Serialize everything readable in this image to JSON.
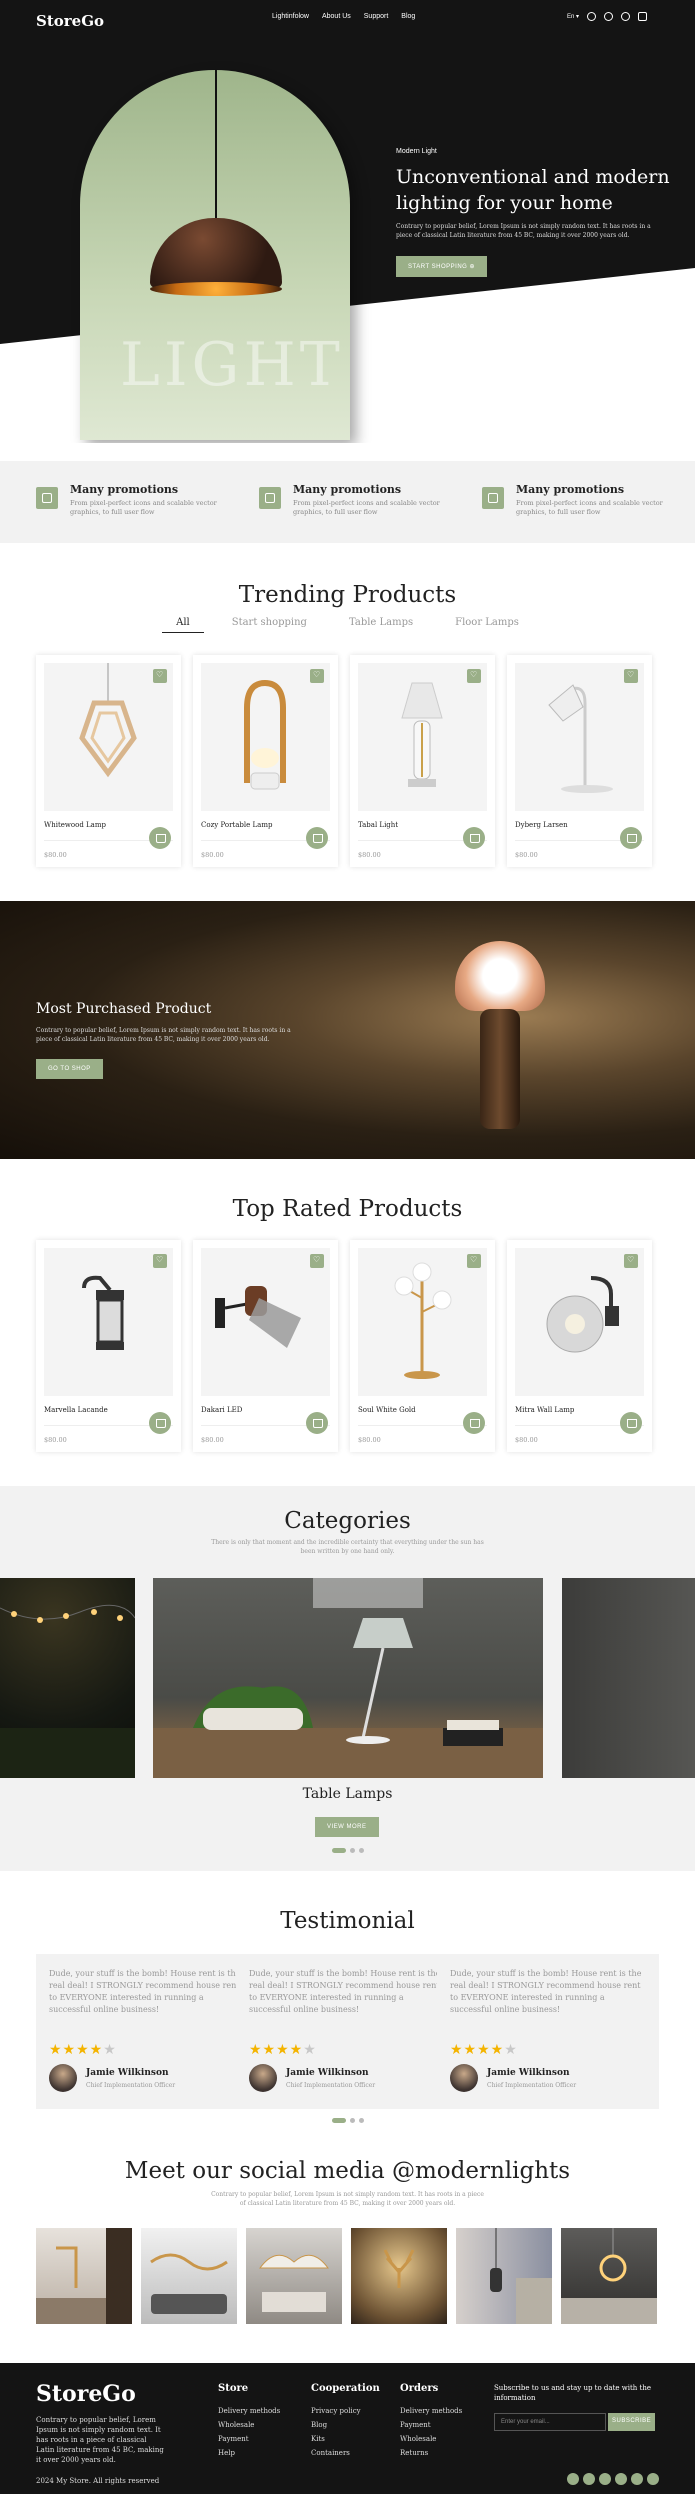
{
  "brand": "StoreGo",
  "nav": {
    "links": [
      "Lightinfolow",
      "About Us",
      "Support",
      "Blog"
    ],
    "lang": "En"
  },
  "hero": {
    "watermark": "LIGHT",
    "subtitle": "Modern Light",
    "title": "Unconventional and modern lighting for your home",
    "text": "Contrary to popular belief, Lorem Ipsum is not simply random text. It has roots in a piece of classical Latin literature from 45 BC, making it over 2000 years old.",
    "button": "START SHOPPING"
  },
  "features": [
    {
      "title": "Many promotions",
      "text": "From pixel-perfect icons and scalable vector graphics, to full user flow"
    },
    {
      "title": "Many promotions",
      "text": "From pixel-perfect icons and scalable vector graphics, to full user flow"
    },
    {
      "title": "Many promotions",
      "text": "From pixel-perfect icons and scalable vector graphics, to full user flow"
    }
  ],
  "trending": {
    "title": "Trending Products",
    "tabs": [
      "All",
      "Start shopping",
      "Table Lamps",
      "Floor Lamps"
    ],
    "products": [
      {
        "name": "Whitewood Lamp",
        "price": "$80.00"
      },
      {
        "name": "Cozy Portable Lamp",
        "price": "$80.00"
      },
      {
        "name": "Tabal Light",
        "price": "$80.00"
      },
      {
        "name": "Dyberg Larsen",
        "price": "$80.00"
      }
    ]
  },
  "banner": {
    "title": "Most Purchased Product",
    "text": "Contrary to popular belief, Lorem Ipsum is not simply random text. It has roots in a piece of classical Latin literature from 45 BC, making it over 2000 years old.",
    "button": "GO TO SHOP"
  },
  "top_rated": {
    "title": "Top Rated Products",
    "products": [
      {
        "name": "Marvella Lacande",
        "price": "$80.00"
      },
      {
        "name": "Dakari LED",
        "price": "$80.00"
      },
      {
        "name": "Soul White Gold",
        "price": "$80.00"
      },
      {
        "name": "Mitra Wall Lamp",
        "price": "$80.00"
      }
    ]
  },
  "categories": {
    "title": "Categories",
    "text": "There is only that moment and the incredible certainty that everything under the sun has been written by one hand only.",
    "current": "Table Lamps",
    "button": "VIEW MORE"
  },
  "testimonial": {
    "title": "Testimonial",
    "items": [
      {
        "text": "Dude, your stuff is the bomb! House rent is the real deal! I STRONGLY recommend house rent to EVERYONE interested in running a successful online business!",
        "rating": 4,
        "name": "Jamie Wilkinson",
        "role": "Chief Implementation Officer"
      },
      {
        "text": "Dude, your stuff is the bomb! House rent is the real deal! I STRONGLY recommend house rent to EVERYONE interested in running a successful online business!",
        "rating": 4,
        "name": "Jamie Wilkinson",
        "role": "Chief Implementation Officer"
      },
      {
        "text": "Dude, your stuff is the bomb! House rent is the real deal! I STRONGLY recommend house rent to EVERYONE interested in running a successful online business!",
        "rating": 4,
        "name": "Jamie Wilkinson",
        "role": "Chief Implementation Officer"
      }
    ]
  },
  "social": {
    "title": "Meet our social media @modernlights",
    "text": "Contrary to popular belief, Lorem Ipsum is not simply random text. It has roots in a piece of classical Latin literature from 45 BC, making it over 2000 years old."
  },
  "footer": {
    "about": "Contrary to popular belief, Lorem Ipsum is not simply random text. It has roots in a piece of classical Latin literature from 45 BC, making it over 2000 years old.",
    "columns": [
      {
        "title": "Store",
        "links": [
          "Delivery methods",
          "Wholesale",
          "Payment",
          "Help"
        ]
      },
      {
        "title": "Cooperation",
        "links": [
          "Privacy policy",
          "Blog",
          "Kits",
          "Containers"
        ]
      },
      {
        "title": "Orders",
        "links": [
          "Delivery methods",
          "Payment",
          "Wholesale",
          "Returns"
        ]
      }
    ],
    "newsletter": "Subscribe to us and stay up to date with the information",
    "email_placeholder": "Enter your email...",
    "subscribe": "SUBSCRIBE",
    "copyright": "2024 My Store. All rights reserved"
  },
  "colors": {
    "accent": "#9aaf88",
    "dark": "#141414",
    "light_bg": "#f2f2f2"
  }
}
